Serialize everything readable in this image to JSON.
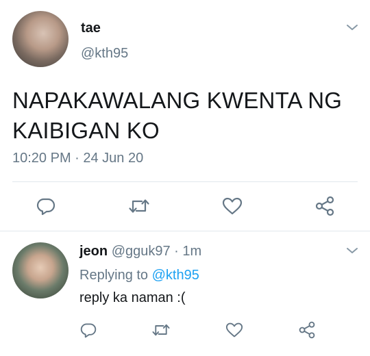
{
  "main_tweet": {
    "display_name": "tae",
    "handle": "@kth95",
    "text_line1": "NAPAKAWALANG KWENTA NG",
    "text_line2": "KAIBIGAN KO",
    "timestamp": "10:20 PM · 24 Jun 20",
    "avatar_icon": "avatar-photo",
    "actions": [
      "reply-icon",
      "retweet-icon",
      "like-icon",
      "share-icon"
    ]
  },
  "reply_tweet": {
    "display_name": "jeon",
    "meta": "@gguk97 · 1m",
    "replying_prefix": "Replying to",
    "replying_handle": "@kth95",
    "text": "reply ka naman :(",
    "avatar_icon": "avatar-photo",
    "actions": [
      "reply-icon",
      "retweet-icon",
      "like-icon",
      "share-icon"
    ]
  },
  "colors": {
    "text": "#14171a",
    "muted": "#657786",
    "link": "#1da1f2",
    "divider": "#e1e8ed"
  }
}
